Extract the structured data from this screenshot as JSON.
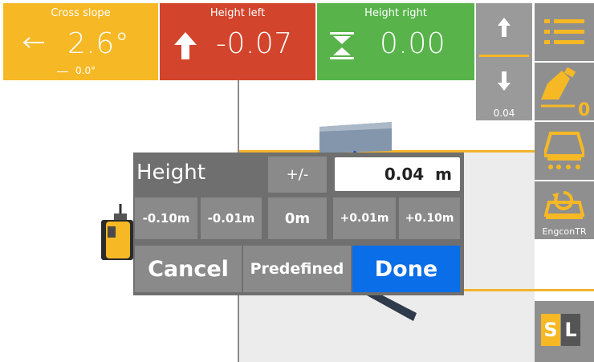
{
  "tiles": {
    "cross_slope": {
      "title": "Cross slope",
      "value": "2.6°",
      "sub": "0.0°",
      "color": "#f6b824",
      "arrow_icon": "arrow-left-icon"
    },
    "height_left": {
      "title": "Height left",
      "value": "-0.07",
      "color": "#d2442b",
      "arrow_icon": "arrow-up-icon"
    },
    "height_right": {
      "title": "Height right",
      "value": "0.00",
      "color": "#57b34a",
      "arrow_icon": "on-grade-icon"
    }
  },
  "toolbar": {
    "offset_value": "0.04",
    "engcon_label": "EngconTR",
    "sl_s": "S",
    "sl_l": "L",
    "accent": "#f6b824"
  },
  "dialog": {
    "title": "Height",
    "sign_toggle": "+/-",
    "input_value": "0.04  m",
    "presets": [
      "-0.10m",
      "-0.01m",
      "0m",
      "+0.01m",
      "+0.10m"
    ],
    "cancel": "Cancel",
    "predefined": "Predefined",
    "done": "Done",
    "done_color": "#0a6ee8"
  }
}
